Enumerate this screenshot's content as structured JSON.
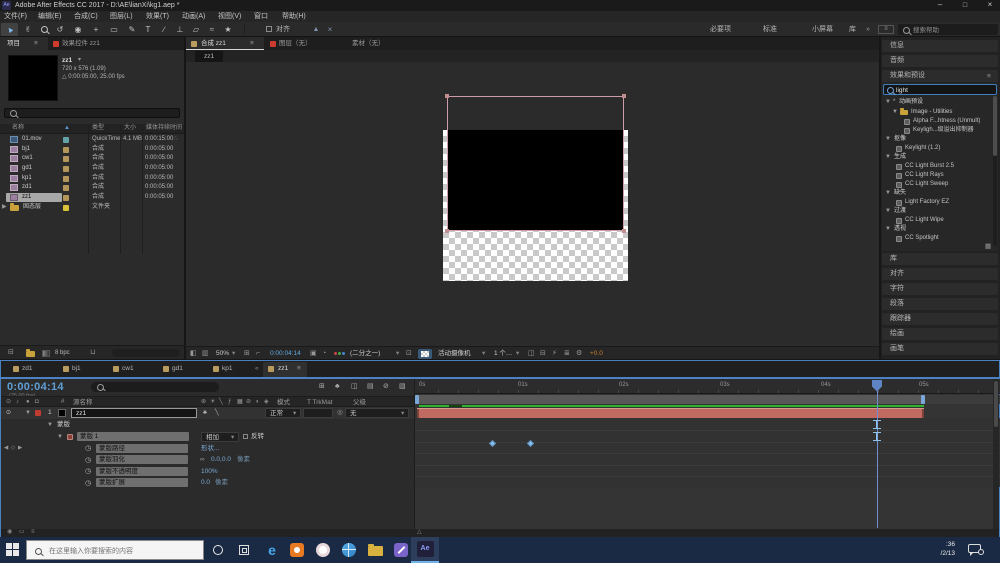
{
  "titlebar": {
    "title": "Adobe After Effects CC 2017 - D:\\AE\\lianXi\\kg1.aep *"
  },
  "menus": [
    "文件(F)",
    "编辑(E)",
    "合成(C)",
    "图层(L)",
    "效果(T)",
    "动画(A)",
    "视图(V)",
    "窗口",
    "帮助(H)"
  ],
  "toolbar": {
    "snap": "对齐",
    "workspaces": [
      "必要项",
      "标准",
      "小屏幕",
      "库"
    ],
    "search_help": "搜索帮助"
  },
  "project": {
    "tab_project": "项目",
    "tab_effect_controls": "效果控件 zz1",
    "preview_name": "zz1",
    "preview_dims": "720 x 576 (1.09)",
    "preview_meta": "△ 0:00:05:00, 25.00 fps",
    "col_name": "名称",
    "col_type": "类型",
    "col_size": "大小",
    "col_duration": "媒体持续时间",
    "items": [
      {
        "name": "01.mov",
        "type": "QuickTime",
        "size": "4.1 MB",
        "duration": "0:00:15:00"
      },
      {
        "name": "bj1",
        "type": "合成",
        "size": "",
        "duration": "0:00:05:00"
      },
      {
        "name": "cw1",
        "type": "合成",
        "size": "",
        "duration": "0:00:05:00"
      },
      {
        "name": "gd1",
        "type": "合成",
        "size": "",
        "duration": "0:00:05:00"
      },
      {
        "name": "kp1",
        "type": "合成",
        "size": "",
        "duration": "0:00:05:00"
      },
      {
        "name": "zd1",
        "type": "合成",
        "size": "",
        "duration": "0:00:05:00"
      },
      {
        "name": "zz1",
        "type": "合成",
        "size": "",
        "duration": "0:00:05:00"
      },
      {
        "name": "固态层",
        "type": "文件夹",
        "size": "",
        "duration": ""
      }
    ],
    "bit_depth": "8 bpc"
  },
  "viewer": {
    "tab_comp": "合成 zz1",
    "tab_layer": "图层（无）",
    "tab_footage": "素材（无）",
    "breadcrumb": "zz1",
    "zoom": "50%",
    "timecode": "0:00:04:14",
    "resolution": "(二分之一)",
    "camera": "活动摄像机",
    "views": "1 个…",
    "exposure": "+0.0"
  },
  "effects": {
    "panel_info": "信息",
    "panel_audio": "音频",
    "title": "效果和预设",
    "search": "light",
    "tree": [
      {
        "label": "动画预设"
      },
      {
        "label": "Image - Utilities"
      },
      {
        "label": "Alpha F...htness (Unmult)"
      },
      {
        "label": "Keyligh...级溢出抑制器"
      },
      {
        "label": "抠像"
      },
      {
        "label": "Keylight (1.2)"
      },
      {
        "label": "生成"
      },
      {
        "label": "CC Light Burst 2.5"
      },
      {
        "label": "CC Light Rays"
      },
      {
        "label": "CC Light Sweep"
      },
      {
        "label": "缺失"
      },
      {
        "label": "Light Factory EZ"
      },
      {
        "label": "过渡"
      },
      {
        "label": "CC Light Wipe"
      },
      {
        "label": "透视"
      },
      {
        "label": "CC Spotlight"
      }
    ],
    "panels_bottom": [
      "库",
      "对齐",
      "字符",
      "段落",
      "跟踪器",
      "绘画",
      "画笔"
    ]
  },
  "timeline": {
    "tabs": [
      "zd1",
      "bj1",
      "cw1",
      "gd1",
      "kp1",
      "zz1"
    ],
    "timecode": "0:00:04:14",
    "fps": "(25.00 fps)",
    "col_source": "源名称",
    "col_mode": "模式",
    "col_trkmat": "T TrkMat",
    "col_parent": "父级",
    "layer_num": "1",
    "layer_name": "zz1",
    "layer_mode": "正常",
    "layer_parent": "无",
    "masks_label": "蒙版",
    "mask_name": "蒙版 1",
    "mask_blend": "相加",
    "mask_invert": "反转",
    "props": [
      {
        "label": "蒙版路径",
        "value": "形状...",
        "unit": ""
      },
      {
        "label": "蒙版羽化",
        "value": "0.0,0.0",
        "unit": "像素"
      },
      {
        "label": "蒙版不透明度",
        "value": "100%",
        "unit": ""
      },
      {
        "label": "蒙版扩展",
        "value": "0.0",
        "unit": "像素"
      }
    ],
    "ticks": [
      "0s",
      "01s",
      "02s",
      "03s",
      "04s",
      "05s"
    ]
  },
  "taskbar": {
    "search_placeholder": "在这里输入你要搜索的内容",
    "time": ":36",
    "date": "/2/13"
  },
  "icons": {
    "ae": "Ae",
    "min": "–",
    "max": "□",
    "close": "×",
    "menu": "≡",
    "over": "»",
    "back": "«",
    "dd": "▾",
    "open": "▼",
    "closed": "▶",
    "asterisk": "*",
    "sel": "▲",
    "hand": "✌",
    "rot": "↺",
    "cam": "◉",
    "pan": "+",
    "rect": "▭",
    "pen": "✎",
    "txt": "T",
    "brush": "∕",
    "stamp": "⊥",
    "eras": "▱",
    "roto": "≈",
    "pup": "★",
    "opt1": "▲",
    "opt2": "×",
    "eye": "⊙",
    "aud": "♪",
    "solo": "●",
    "lock": "◘",
    "hash": "#",
    "sw": [
      "⊛",
      "☀",
      "╲",
      "ƒ",
      "▦",
      "⊘",
      "◑",
      "◈"
    ],
    "tg": [
      "⊞",
      "♣",
      "◫",
      "▤",
      "⊘",
      "▧"
    ],
    "stop": "◷",
    "pick": "◎",
    "link": "∞",
    "kprev": "◀",
    "kdia": "◇",
    "knext": "▶",
    "vf": [
      "◧",
      "▥",
      "⊞",
      "⌐",
      "▣",
      "◔",
      "⊡",
      "◫",
      "⊟",
      "⚡",
      "≣",
      "⚙"
    ],
    "pb1": "⊟",
    "pb2": "⊔",
    "used": "∴",
    "tri": "△",
    "misc": [
      "◉",
      "▭",
      "≡"
    ],
    "sort": "▲"
  }
}
